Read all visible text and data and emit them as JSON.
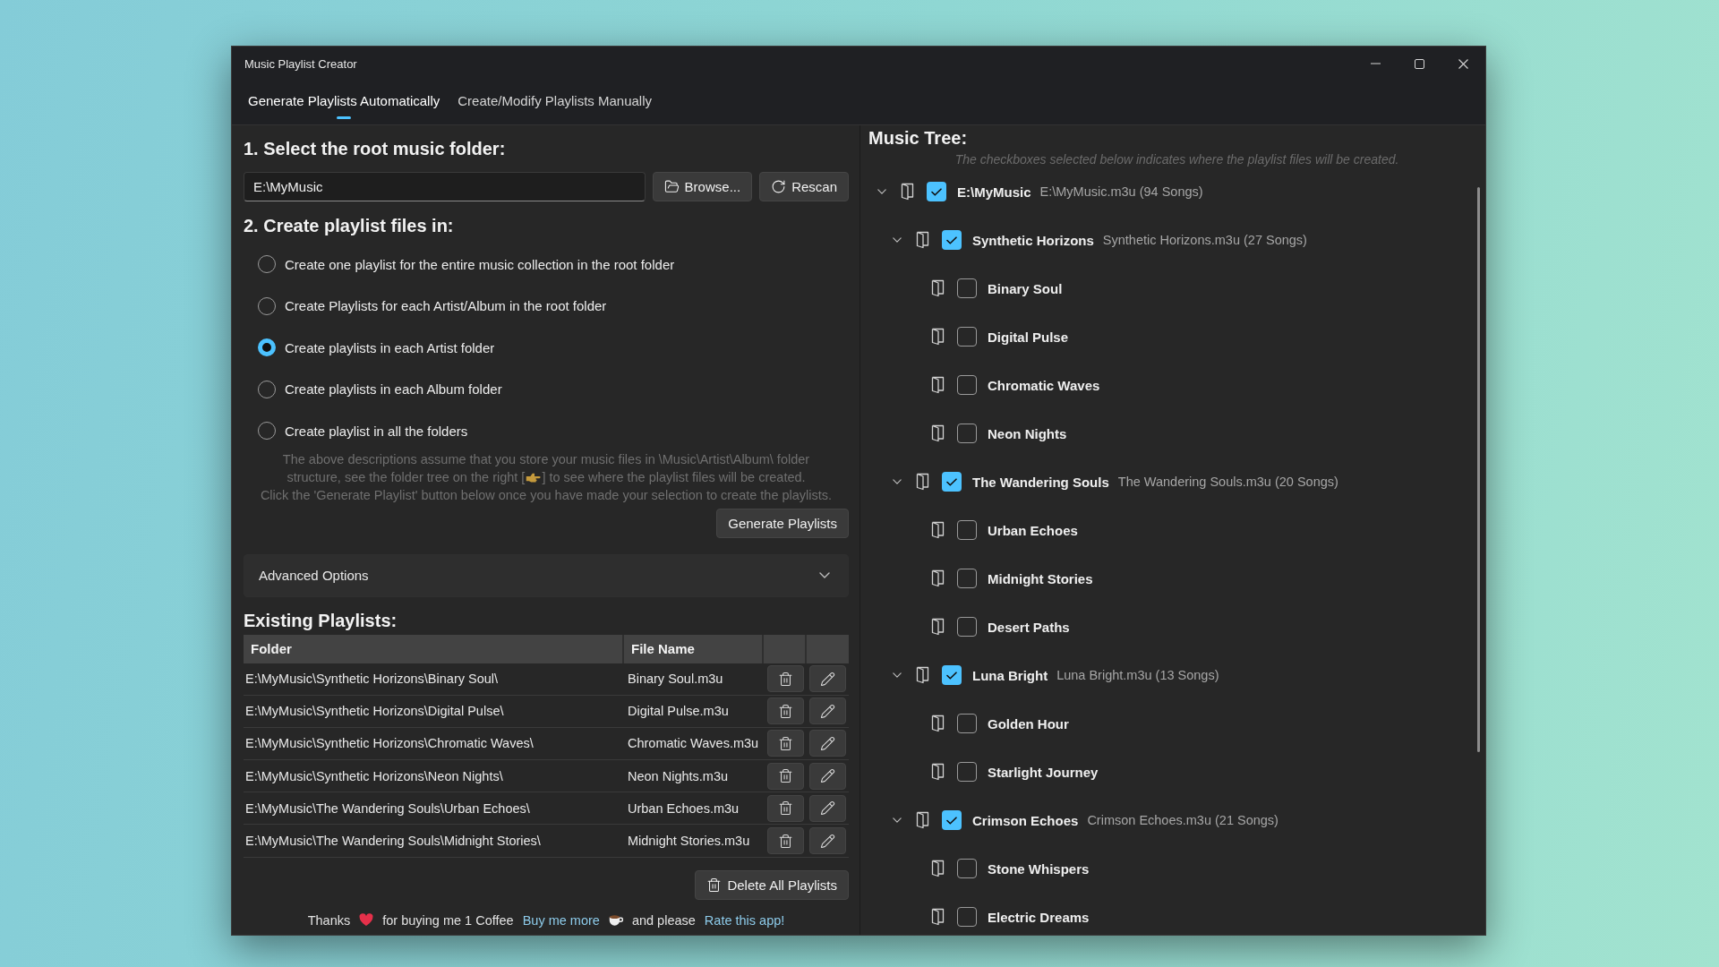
{
  "window": {
    "title": "Music Playlist Creator"
  },
  "tabs": [
    {
      "label": "Generate Playlists Automatically",
      "selected": true
    },
    {
      "label": "Create/Modify Playlists Manually",
      "selected": false
    }
  ],
  "root_folder": {
    "heading": "1. Select the root music folder:",
    "value": "E:\\MyMusic",
    "buttons": [
      {
        "kind": "browse",
        "label": "Browse..."
      },
      {
        "kind": "rescan",
        "label": "Rescan"
      }
    ]
  },
  "playlist_location": {
    "heading": "2. Create playlist files in:",
    "options": [
      {
        "label": "Create one playlist for the entire music collection in the root folder",
        "selected": false
      },
      {
        "label": "Create Playlists for each Artist/Album in the root folder",
        "selected": false
      },
      {
        "label": "Create playlists in each Artist folder",
        "selected": true
      },
      {
        "label": "Create playlists in each Album folder",
        "selected": false
      },
      {
        "label": "Create playlist in all the folders",
        "selected": false
      }
    ],
    "description_lines": [
      [
        "The above descriptions assume that you store your music files in \\Music\\Artist\\Album\\ folder"
      ],
      [
        "structure, see the folder tree on the right [",
        "] to see where the playlist files will be created."
      ],
      [
        "Click the 'Generate Playlist' button below once you have made your selection to create the playlists."
      ]
    ],
    "generate_button": "Generate Playlists"
  },
  "advanced_options": {
    "label": "Advanced Options",
    "expanded": false
  },
  "existing_playlists": {
    "heading": "Existing Playlists:",
    "columns": [
      "Folder",
      "File Name"
    ],
    "rows": [
      {
        "folder": "E:\\MyMusic\\Synthetic Horizons\\Binary Soul\\",
        "file_name": "Binary Soul.m3u"
      },
      {
        "folder": "E:\\MyMusic\\Synthetic Horizons\\Digital Pulse\\",
        "file_name": "Digital Pulse.m3u"
      },
      {
        "folder": "E:\\MyMusic\\Synthetic Horizons\\Chromatic Waves\\",
        "file_name": "Chromatic Waves.m3u"
      },
      {
        "folder": "E:\\MyMusic\\Synthetic Horizons\\Neon Nights\\",
        "file_name": "Neon Nights.m3u"
      },
      {
        "folder": "E:\\MyMusic\\The Wandering Souls\\Urban Echoes\\",
        "file_name": "Urban Echoes.m3u"
      },
      {
        "folder": "E:\\MyMusic\\The Wandering Souls\\Midnight Stories\\",
        "file_name": "Midnight Stories.m3u"
      }
    ],
    "delete_all_button": "Delete All Playlists"
  },
  "footer": {
    "thanks": "Thanks",
    "note": "for buying me 1 Coffee",
    "buy_more_link": "Buy me more",
    "connector": "and please",
    "rate_link": "Rate this app!"
  },
  "music_tree": {
    "heading": "Music Tree:",
    "hint": "The checkboxes selected below indicates where the playlist files will be created.",
    "nodes": [
      {
        "name": "E:\\MyMusic",
        "playlist": "E:\\MyMusic.m3u (94 Songs)",
        "checked": true,
        "expanded": true,
        "children": [
          {
            "name": "Synthetic Horizons",
            "playlist": "Synthetic Horizons.m3u (27 Songs)",
            "checked": true,
            "expanded": true,
            "children": [
              {
                "name": "Binary Soul",
                "checked": false
              },
              {
                "name": "Digital Pulse",
                "checked": false
              },
              {
                "name": "Chromatic Waves",
                "checked": false
              },
              {
                "name": "Neon Nights",
                "checked": false
              }
            ]
          },
          {
            "name": "The Wandering Souls",
            "playlist": "The Wandering Souls.m3u (20 Songs)",
            "checked": true,
            "expanded": true,
            "children": [
              {
                "name": "Urban Echoes",
                "checked": false
              },
              {
                "name": "Midnight Stories",
                "checked": false
              },
              {
                "name": "Desert Paths",
                "checked": false
              }
            ]
          },
          {
            "name": "Luna Bright",
            "playlist": "Luna Bright.m3u (13 Songs)",
            "checked": true,
            "expanded": true,
            "children": [
              {
                "name": "Golden Hour",
                "checked": false
              },
              {
                "name": "Starlight Journey",
                "checked": false
              }
            ]
          },
          {
            "name": "Crimson Echoes",
            "playlist": "Crimson Echoes.m3u (21 Songs)",
            "checked": true,
            "expanded": true,
            "children": [
              {
                "name": "Stone Whispers",
                "checked": false
              },
              {
                "name": "Electric Dreams",
                "checked": false
              }
            ]
          }
        ]
      }
    ]
  }
}
